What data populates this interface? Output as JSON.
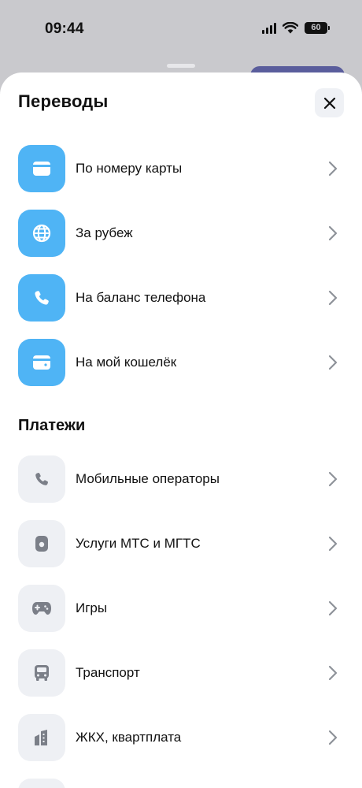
{
  "status_bar": {
    "time": "09:44",
    "battery": "60"
  },
  "sheet": {
    "title": "Переводы",
    "close_icon": "close-icon"
  },
  "transfers": [
    {
      "label": "По номеру карты",
      "icon": "card-icon"
    },
    {
      "label": "За рубеж",
      "icon": "globe-icon"
    },
    {
      "label": "На баланс телефона",
      "icon": "phone-icon"
    },
    {
      "label": "На мой кошелёк",
      "icon": "wallet-icon"
    }
  ],
  "payments_section": {
    "title": "Платежи",
    "items": [
      {
        "label": "Мобильные операторы",
        "icon": "phone-icon"
      },
      {
        "label": "Услуги МТС и МГТС",
        "icon": "home-device-icon"
      },
      {
        "label": "Игры",
        "icon": "gamepad-icon"
      },
      {
        "label": "Транспорт",
        "icon": "bus-icon"
      },
      {
        "label": "ЖКХ, квартплата",
        "icon": "building-icon"
      }
    ]
  },
  "colors": {
    "transfer_tile": "#4fb4f5",
    "payment_tile": "#eef0f4",
    "payment_icon": "#7b7f88",
    "chevron": "#8e9299"
  }
}
